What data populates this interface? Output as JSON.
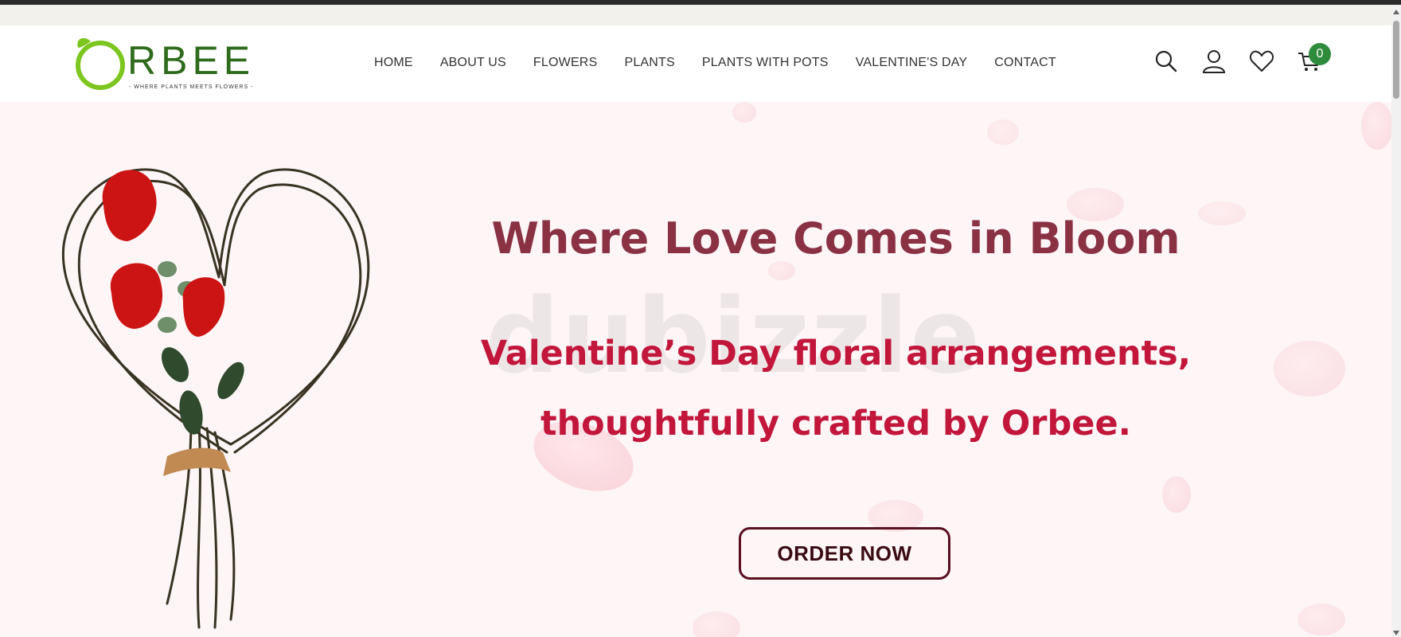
{
  "brand": {
    "name": "RBEE",
    "tagline": "- WHERE PLANTS MEETS FLOWERS -"
  },
  "nav": {
    "items": [
      {
        "label": "HOME"
      },
      {
        "label": "ABOUT US"
      },
      {
        "label": "FLOWERS"
      },
      {
        "label": "PLANTS"
      },
      {
        "label": "PLANTS WITH POTS"
      },
      {
        "label": "VALENTINE'S DAY"
      },
      {
        "label": "CONTACT"
      }
    ]
  },
  "header_icons": {
    "search": "search-icon",
    "account": "user-icon",
    "wishlist": "heart-icon",
    "cart": "cart-icon",
    "cart_count": "0"
  },
  "hero": {
    "headline": "Where Love Comes in Bloom",
    "subline": "Valentine’s Day floral arrangements, thoughtfully crafted by Orbee.",
    "cta_label": "ORDER NOW",
    "watermark": "dubizzle"
  },
  "colors": {
    "brand_green": "#2f6b1d",
    "logo_lime": "#7dc51f",
    "headline": "#8a3144",
    "subline": "#c2163b",
    "cta_border": "#5a1020",
    "hero_bg": "#fdf5f6",
    "cart_badge": "#2e8b3c"
  }
}
